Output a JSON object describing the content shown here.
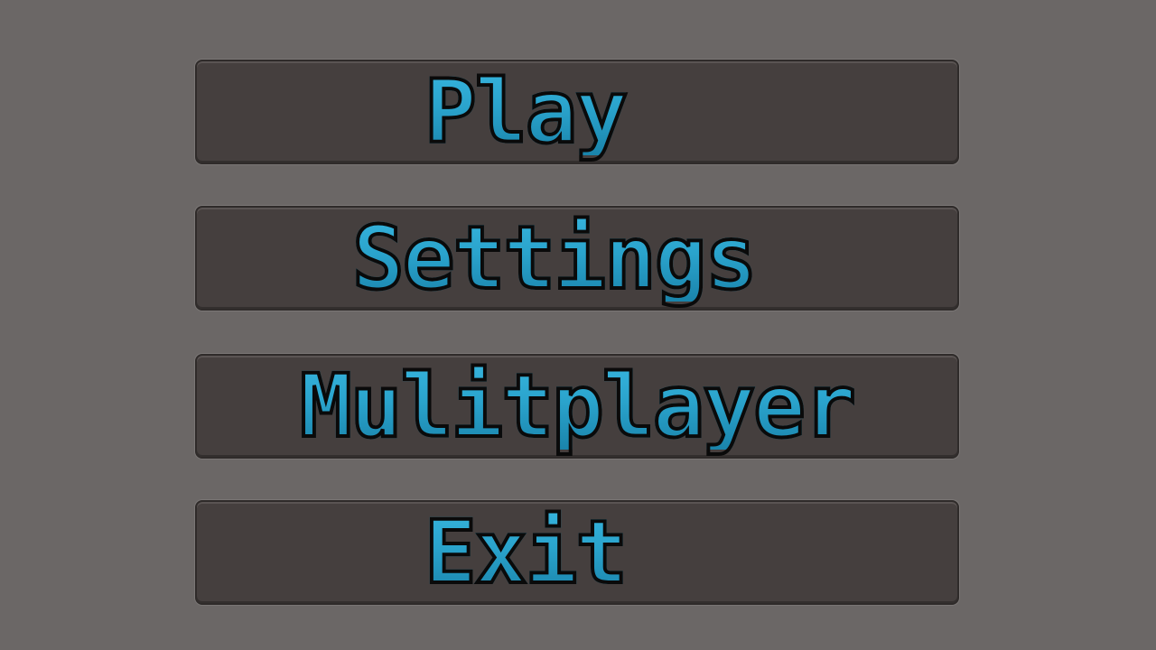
{
  "main_menu": {
    "buttons": [
      {
        "id": "play",
        "label": "Play"
      },
      {
        "id": "settings",
        "label": "Settings"
      },
      {
        "id": "multiplayer",
        "label": "Mulitplayer"
      },
      {
        "id": "exit",
        "label": "Exit"
      }
    ]
  },
  "colors": {
    "background": "#6b6766",
    "button_fill": "#453f3e",
    "text_fill": "#2aa3cc",
    "text_outline": "#0a0a0a"
  }
}
